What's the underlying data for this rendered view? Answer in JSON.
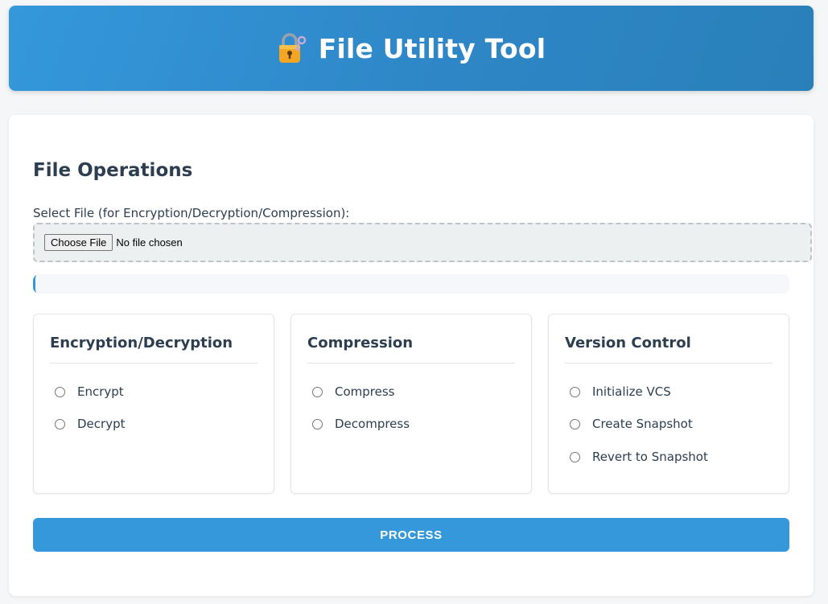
{
  "header": {
    "icon": "lock-with-key-icon",
    "title": "File Utility Tool"
  },
  "file_operations": {
    "title": "File Operations",
    "file_label": "Select File (for Encryption/Decryption/Compression):",
    "choose_button": "Choose File",
    "file_status": "No file chosen",
    "progress_percent": 0
  },
  "panels": [
    {
      "title": "Encryption/Decryption",
      "options": [
        "Encrypt",
        "Decrypt"
      ]
    },
    {
      "title": "Compression",
      "options": [
        "Compress",
        "Decompress"
      ]
    },
    {
      "title": "Version Control",
      "options": [
        "Initialize VCS",
        "Create Snapshot",
        "Revert to Snapshot"
      ]
    }
  ],
  "actions": {
    "process_label": "PROCESS"
  },
  "colors": {
    "accent": "#3498db",
    "text": "#2c3e50"
  }
}
